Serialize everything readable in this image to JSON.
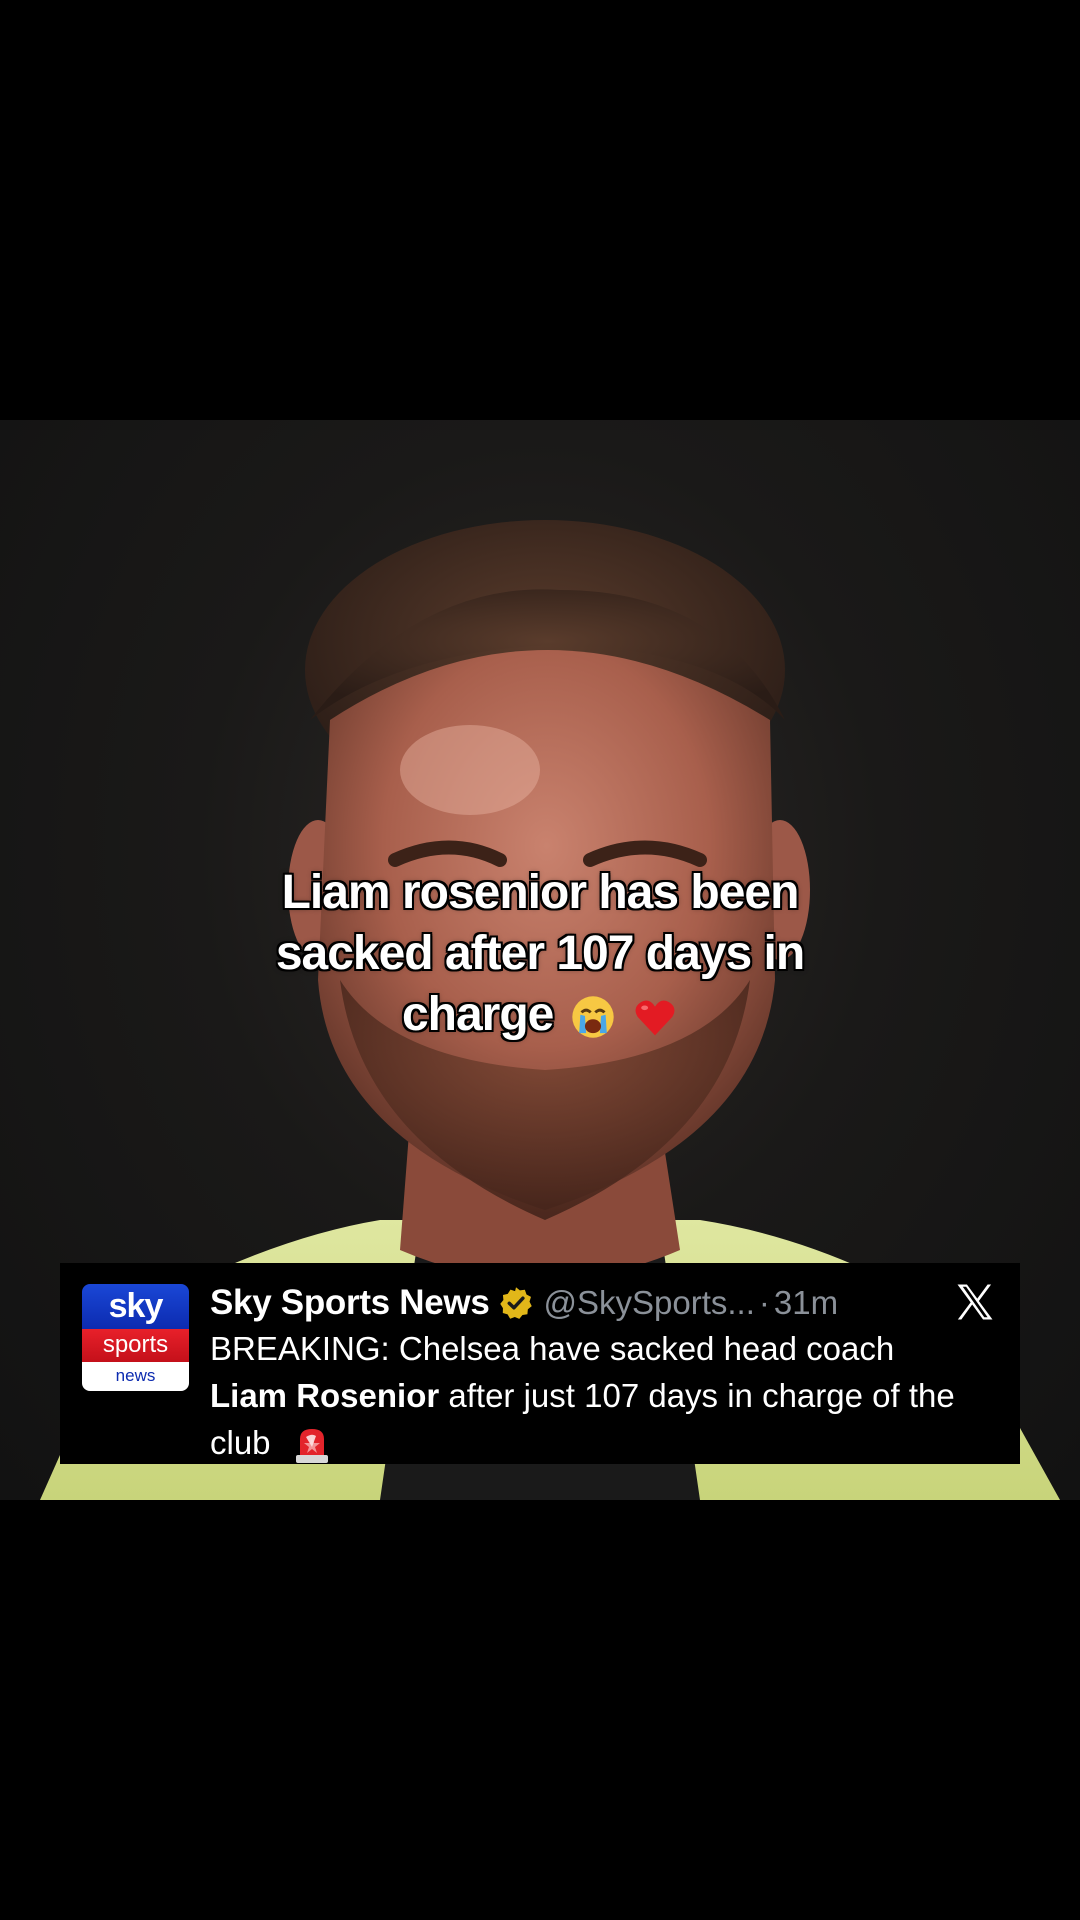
{
  "caption": {
    "line1": "Liam rosenior has been",
    "line2": "sacked after 107 days in",
    "line3": "charge"
  },
  "tweet": {
    "logo": {
      "top": "sky",
      "middle": "sports",
      "bottom": "news"
    },
    "author_name": "Sky Sports News",
    "handle": "@SkySports...",
    "separator": "·",
    "time": "31m",
    "text_part1": "BREAKING: Chelsea have sacked head coach",
    "text_bold": "Liam Rosenior",
    "text_part2": " after just 107 days in charge of the club"
  },
  "colors": {
    "background": "#000000",
    "sky_blue": "#0c2bb0",
    "sky_red": "#e8202a",
    "verified_gold": "#e2b719",
    "handle_gray": "#8b9199"
  },
  "icons": [
    "verified-badge-icon",
    "x-logo-icon",
    "crying-face-emoji",
    "red-heart-emoji",
    "siren-emoji"
  ]
}
